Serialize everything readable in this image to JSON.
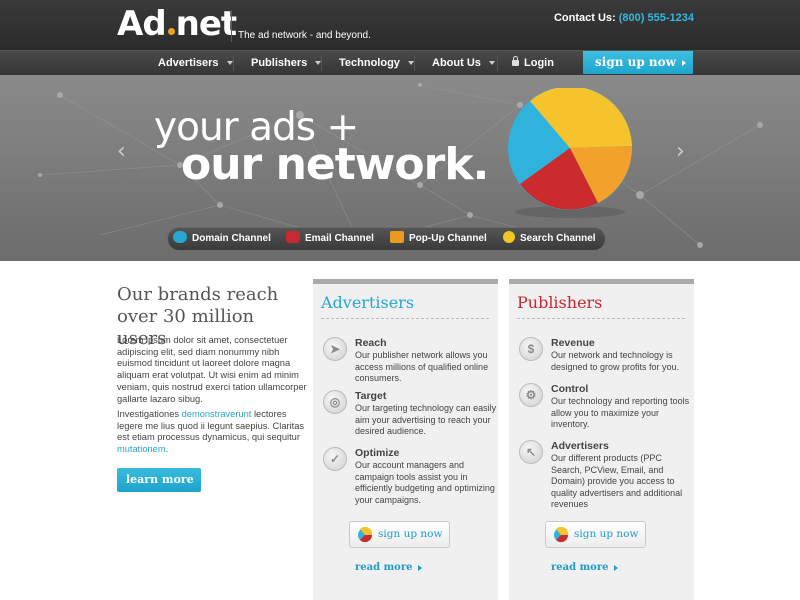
{
  "header": {
    "logo": "Ad",
    "logo_suffix": "net",
    "tagline": "The ad network - and beyond.",
    "contact_label": "Contact Us:",
    "contact_phone": "(800) 555-1234"
  },
  "nav": {
    "items": [
      {
        "label": "Advertisers"
      },
      {
        "label": "Publishers"
      },
      {
        "label": "Technology"
      },
      {
        "label": "About Us"
      },
      {
        "label": "Login"
      }
    ],
    "signup_label": "sign up now"
  },
  "hero": {
    "line1": "your ads +",
    "line2": "our network.",
    "prev_arrow": "‹",
    "next_arrow": "›",
    "channels": [
      {
        "label": "Domain Channel",
        "icon": "www-icon"
      },
      {
        "label": "Email Channel",
        "icon": "email-icon"
      },
      {
        "label": "Pop-Up Channel",
        "icon": "popup-icon"
      },
      {
        "label": "Search Channel",
        "icon": "search-icon"
      }
    ]
  },
  "intro": {
    "title": "Our brands reach over 30 million users",
    "para1": "Lorem ipsum dolor sit amet, consectetuer adipiscing elit, sed diam nonummy nibh euismod tincidunt ut laoreet dolore magna aliquam erat volutpat. Ut wisi enim ad minim veniam, quis nostrud exerci tation ullamcorper gallarte lazaro sibug.",
    "para2_a": "Investigationes ",
    "para2_link1": "demonstraverunt",
    "para2_b": " lectores legere me lius quod ii legunt saepius. Claritas est etiam processus dynamicus, qui sequitur ",
    "para2_link2": "mutationem",
    "para2_c": ".",
    "learn_more": "learn more"
  },
  "advertisers": {
    "title": "Advertisers",
    "features": [
      {
        "title": "Reach",
        "body": "Our publisher network allows you access millions of qualified online consumers.",
        "icon": "compass-icon"
      },
      {
        "title": "Target",
        "body": "Our targeting technology can easily aim your advertising to reach your desired audience.",
        "icon": "target-icon"
      },
      {
        "title": "Optimize",
        "body": "Our account managers and campaign tools assist you in efficiently budgeting and optimizing your campaigns.",
        "icon": "checkmark-icon"
      }
    ],
    "signup": "sign up now",
    "read_more": "read more"
  },
  "publishers": {
    "title": "Publishers",
    "features": [
      {
        "title": "Revenue",
        "body": "Our network and technology is designed to grow profits for you.",
        "icon": "dollar-icon"
      },
      {
        "title": "Control",
        "body": "Our technology and reporting tools allow you to maximize your inventory.",
        "icon": "gear-icon"
      },
      {
        "title": "Advertisers",
        "body": "Our different products (PPC Search, PCView, Email, and Domain) provide you access to quality advertisers and additional revenues",
        "icon": "cursor-icon"
      }
    ],
    "signup": "sign up now",
    "read_more": "read more"
  },
  "colors": {
    "accent_blue": "#28a6d1",
    "accent_red": "#c5272e",
    "pie_yellow": "#f5c32c",
    "pie_red": "#cc2b2e",
    "pie_blue": "#2fb3dd",
    "pie_orange": "#f2a22a"
  }
}
